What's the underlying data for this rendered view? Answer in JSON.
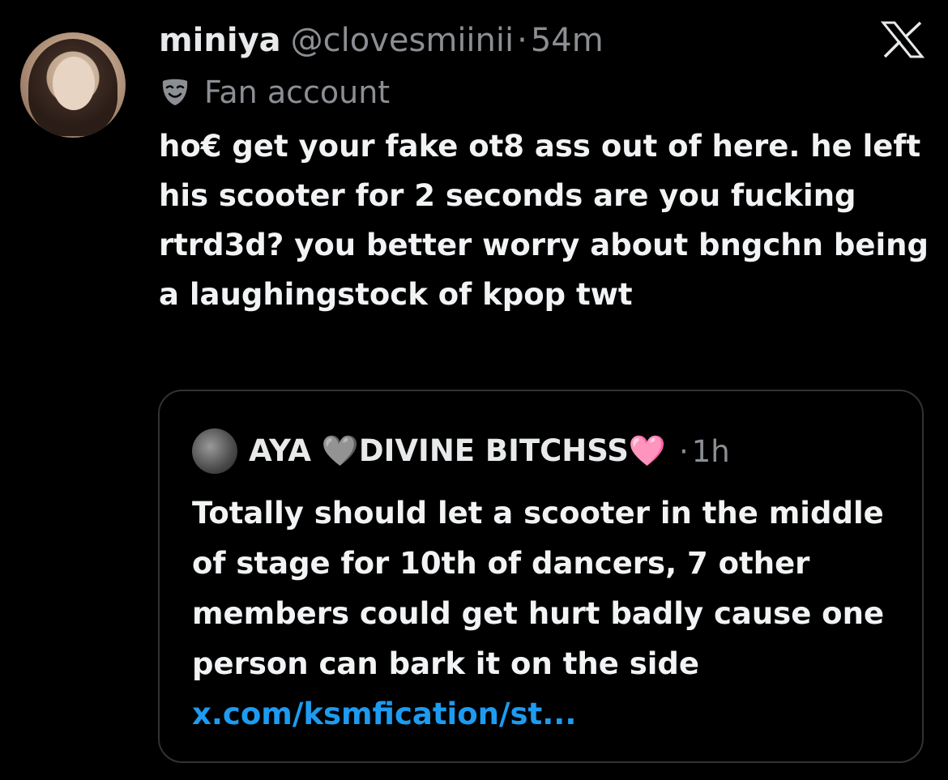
{
  "post": {
    "display_name": "miniya",
    "handle": "@clovesmiinii",
    "separator": "·",
    "time": "54m",
    "label": "Fan account",
    "text": "ho€ get your fake ot8 ass out of here. he left his scooter for 2 seconds are you fucking rtrd3d? you better worry about bngchn being a laughingstock of kpop twt"
  },
  "quote": {
    "display_name": "AYA 🩶DIVINE BITCHSS🩷",
    "separator": "·",
    "time": "1h",
    "text": "Totally should let a scooter in the middle of stage for 10th of dancers, 7 other members could get hurt badly cause one person can bark it on the side ",
    "link": "x.com/ksmfication/st..."
  },
  "icons": {
    "x_logo": "x-logo-icon",
    "label_icon": "mask-icon"
  },
  "colors": {
    "background": "#000000",
    "text": "#e7e9ea",
    "muted": "#8b8f94",
    "link": "#1d9bf0",
    "border": "#2f3336"
  }
}
